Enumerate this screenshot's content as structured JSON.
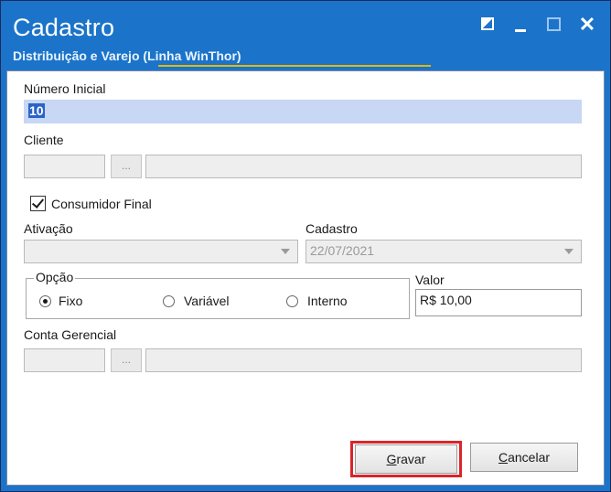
{
  "window": {
    "title": "Cadastro",
    "subtitle": "Distribuição e Varejo (Linha WinThor)",
    "controls": {
      "close_glyph": "✕"
    }
  },
  "form": {
    "numero_inicial": {
      "label": "Número Inicial",
      "value": "10"
    },
    "cliente": {
      "label": "Cliente",
      "code_value": "",
      "browse_label": "...",
      "name_value": ""
    },
    "consumidor_final": {
      "label": "Consumidor Final",
      "checked": true
    },
    "ativacao": {
      "label": "Ativação",
      "value": ""
    },
    "cadastro": {
      "label": "Cadastro",
      "value": "22/07/2021"
    },
    "opcao": {
      "label": "Opção",
      "options": [
        {
          "label": "Fixo",
          "selected": true
        },
        {
          "label": "Variável",
          "selected": false
        },
        {
          "label": "Interno",
          "selected": false
        }
      ]
    },
    "valor": {
      "label": "Valor",
      "value": "R$ 10,00"
    },
    "conta_gerencial": {
      "label": "Conta Gerencial",
      "code_value": "",
      "browse_label": "...",
      "name_value": ""
    }
  },
  "buttons": {
    "gravar": {
      "prefix": "",
      "accel": "G",
      "rest": "ravar"
    },
    "cancelar": {
      "prefix": "",
      "accel": "C",
      "rest": "ancelar"
    }
  },
  "colors": {
    "titlebar": "#1b74c9",
    "highlight": "#d9252b",
    "selection": "#2a63c8"
  }
}
